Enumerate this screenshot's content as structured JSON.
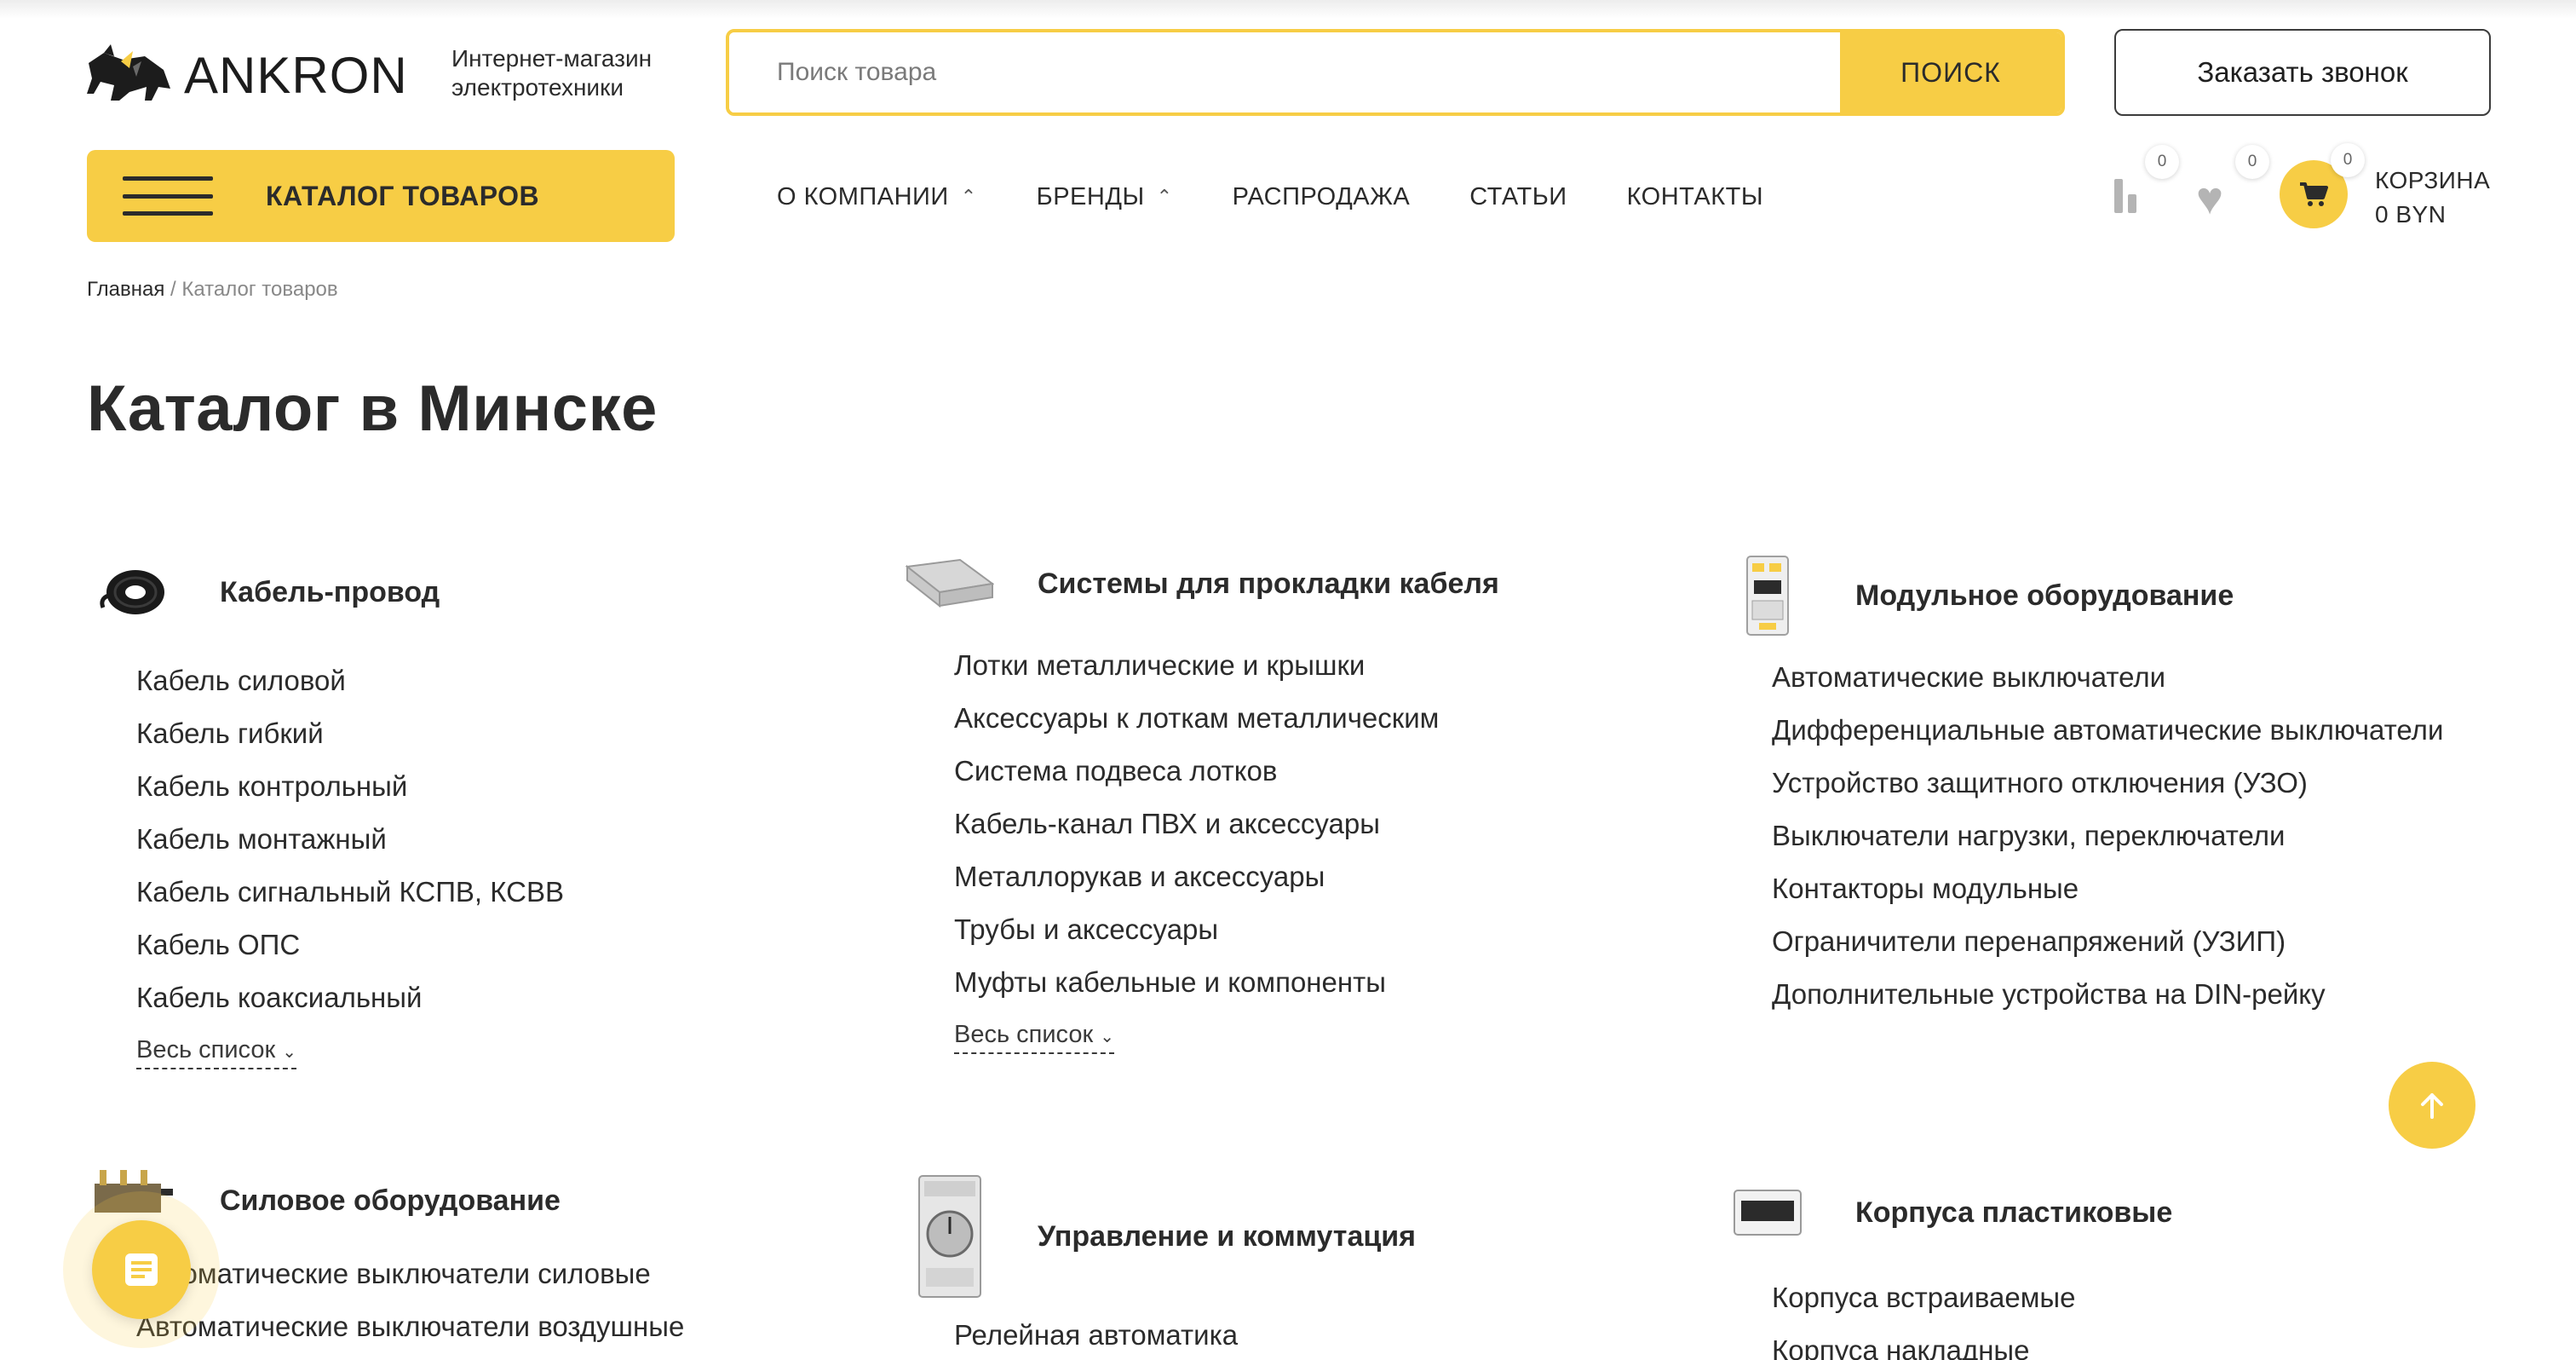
{
  "header": {
    "logo_text": "ANKRON",
    "tagline_line1": "Интернет-магазин",
    "tagline_line2": "электротехники",
    "search_placeholder": "Поиск товара",
    "search_button": "ПОИСК",
    "callback_button": "Заказать звонок",
    "catalog_button": "КАТАЛОГ ТОВАРОВ",
    "nav": [
      {
        "label": "О КОМПАНИИ"
      },
      {
        "label": "БРЕНДЫ"
      },
      {
        "label": "РАСПРОДАЖА"
      },
      {
        "label": "СТАТЬИ"
      },
      {
        "label": "КОНТАКТЫ"
      }
    ],
    "compare_count": "0",
    "favorites_count": "0",
    "cart_count": "0",
    "cart_label": "КОРЗИНА",
    "cart_total": "0 BYN"
  },
  "breadcrumb": {
    "home": "Главная",
    "separator": " / ",
    "current": "Каталог товаров"
  },
  "page_title": "Каталог в Минске",
  "categories": [
    {
      "title": "Кабель-провод",
      "items": [
        "Кабель силовой",
        "Кабель гибкий",
        "Кабель контрольный",
        "Кабель монтажный",
        "Кабель сигнальный КСПВ, КСВВ",
        "Кабель ОПС",
        "Кабель коаксиальный"
      ],
      "more": "Весь список"
    },
    {
      "title": "Системы для прокладки кабеля",
      "items": [
        "Лотки металлические и крышки",
        "Аксессуары к лоткам металлическим",
        "Система подвеса лотков",
        "Кабель-канал ПВХ и аксессуары",
        "Металлорукав и аксессуары",
        "Трубы и аксессуары",
        "Муфты кабельные и компоненты"
      ],
      "more": "Весь список"
    },
    {
      "title": "Модульное оборудование",
      "items": [
        "Автоматические выключатели",
        "Дифференциальные автоматические выключатели",
        "Устройство защитного отключения (УЗО)",
        "Выключатели нагрузки, переключатели",
        "Контакторы модульные",
        "Ограничители перенапряжений (УЗИП)",
        "Дополнительные устройства на DIN-рейку"
      ]
    },
    {
      "title": "Силовое оборудование",
      "items": [
        "Автоматические выключатели силовые",
        "Автоматические выключатели воздушные"
      ]
    },
    {
      "title": "Управление и коммутация",
      "items": [
        "Релейная автоматика"
      ]
    },
    {
      "title": "Корпуса пластиковые",
      "items": [
        "Корпуса встраиваемые",
        "Корпуса накладные"
      ]
    }
  ],
  "colors": {
    "accent": "#f7cd45",
    "text": "#2b2b2b",
    "muted": "#b4b4b4"
  }
}
